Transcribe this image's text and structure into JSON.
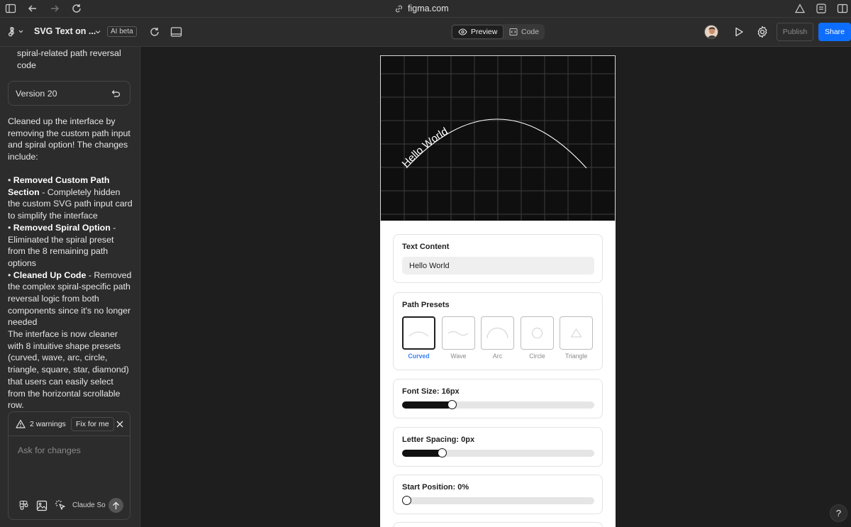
{
  "browser": {
    "url": "figma.com"
  },
  "header": {
    "file_title": "SVG Text on ...",
    "ai_badge": "AI beta",
    "preview_label": "Preview",
    "code_label": "Code",
    "publish_label": "Publish",
    "share_label": "Share",
    "share_color": "#0d6efd"
  },
  "chat": {
    "intro_tail": "spiral-related path reversal code",
    "version_label": "Version 20",
    "para1": "Cleaned up the interface by removing the custom path input and spiral option! The changes include:",
    "bullets": [
      {
        "title": "Removed Custom Path Section",
        "text": " - Completely hidden the custom SVG path input card to simplify the interface"
      },
      {
        "title": "Removed Spiral Option",
        "text": " - Eliminated the spiral preset from the 8 remaining path options"
      },
      {
        "title": "Cleaned Up Code",
        "text": " - Removed the complex spiral-specific path reversal logic from both components since it's no longer needed"
      }
    ],
    "para2": "The interface is now cleaner with 8 intuitive shape presets (curved, wave, arc, circle, triangle, square, star, diamond) that users can easily select from the horizontal scrollable row.",
    "warnings_label": "2 warnings",
    "fix_label": "Fix for me",
    "input_placeholder": "Ask for changes",
    "model_label": "Claude So"
  },
  "preview": {
    "svg_text": "Hello World",
    "text_content": {
      "label": "Text Content",
      "value": "Hello World"
    },
    "path_presets": {
      "label": "Path Presets",
      "items": [
        {
          "label": "Curved",
          "selected": true,
          "icon": "curve-icon"
        },
        {
          "label": "Wave",
          "selected": false,
          "icon": "wave-icon"
        },
        {
          "label": "Arc",
          "selected": false,
          "icon": "arc-icon"
        },
        {
          "label": "Circle",
          "selected": false,
          "icon": "circle-icon"
        },
        {
          "label": "Triangle",
          "selected": false,
          "icon": "triangle-icon"
        }
      ],
      "selected_color": "#3b82f6"
    },
    "font_size": {
      "label": "Font Size: 16px",
      "value_fraction": 0.26
    },
    "letter_spacing": {
      "label": "Letter Spacing: 0px",
      "value_fraction": 0.21
    },
    "start_position": {
      "label": "Start Position: 0%",
      "value_fraction": 0.0
    }
  },
  "help": {
    "label": "?"
  }
}
